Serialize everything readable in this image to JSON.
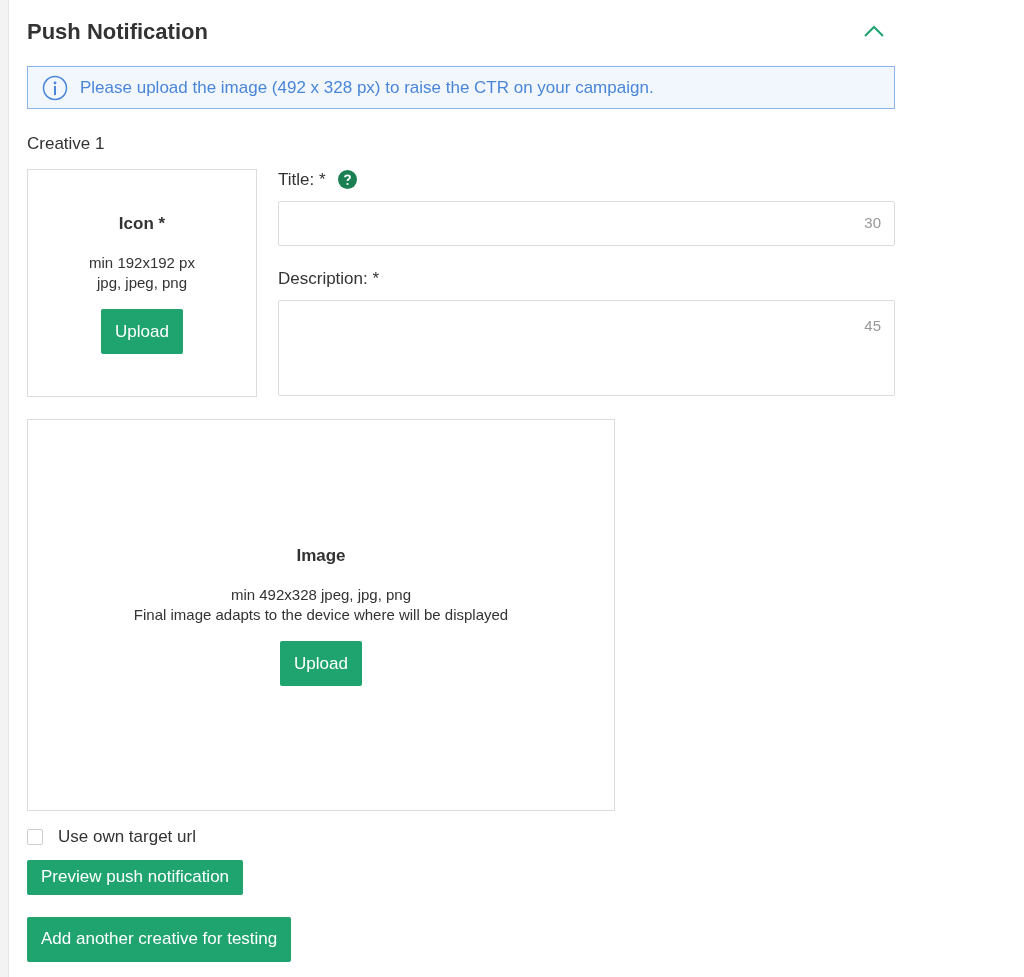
{
  "section": {
    "title": "Push Notification",
    "expanded": true
  },
  "info": "Please upload the image (492 x 328 px) to raise the CTR on your campaign.",
  "creative": {
    "label": "Creative 1",
    "icon_upload": {
      "title": "Icon *",
      "lines": [
        "min 192x192 px",
        "jpg, jpeg, png"
      ],
      "button": "Upload"
    },
    "fields": [
      {
        "label": "Title: *",
        "help": true,
        "counter": "30",
        "kind": "input"
      },
      {
        "label": "Description: *",
        "help": false,
        "counter": "45",
        "kind": "textarea"
      }
    ],
    "image_upload": {
      "title": "Image",
      "lines": [
        "min 492x328 jpeg, jpg, png",
        "Final image adapts to the device where will be displayed"
      ],
      "button": "Upload"
    }
  },
  "own_url": {
    "label": "Use own target url",
    "checked": false
  },
  "buttons": [
    "Preview push notification",
    "Add another creative for testing"
  ]
}
